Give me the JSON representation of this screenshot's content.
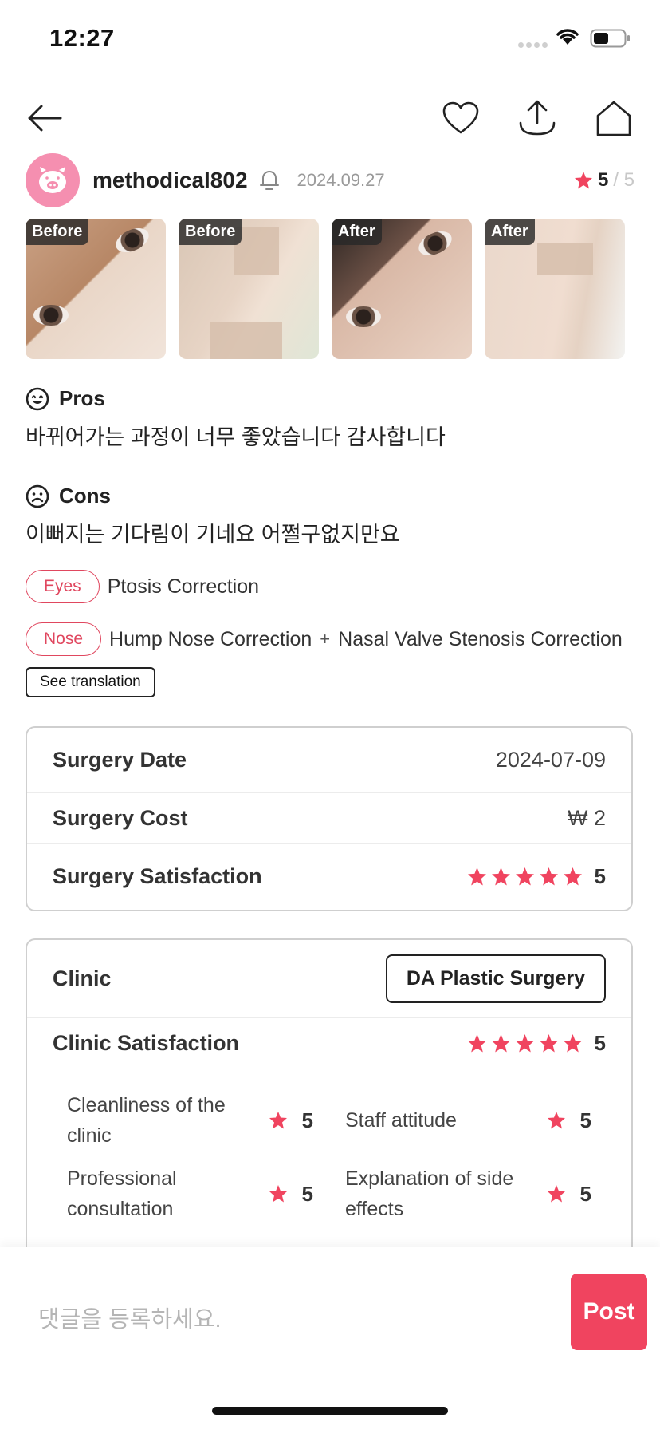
{
  "status_bar": {
    "time": "12:27"
  },
  "nav": {
    "icons": [
      "back-arrow-icon",
      "heart-icon",
      "share-upload-icon",
      "home-icon"
    ]
  },
  "post": {
    "username": "methodical802",
    "date": "2024.09.27",
    "rating": "5",
    "rating_max": "/ 5"
  },
  "photos": [
    {
      "tag": "Before"
    },
    {
      "tag": "Before"
    },
    {
      "tag": "After"
    },
    {
      "tag": "After"
    }
  ],
  "pros": {
    "label": "Pros",
    "text": "바뀌어가는 과정이 너무 좋았습니다 감사합니다"
  },
  "cons": {
    "label": "Cons",
    "text": "이뻐지는 기다림이 기네요 어쩔구없지만요"
  },
  "procedures": [
    {
      "category": "Eyes",
      "items": [
        "Ptosis Correction"
      ]
    },
    {
      "category": "Nose",
      "items": [
        "Hump Nose Correction",
        "+",
        "Nasal Valve Stenosis Correction"
      ]
    }
  ],
  "see_translation": "See translation",
  "surgery_info": {
    "date_label": "Surgery Date",
    "date_value": "2024-07-09",
    "cost_label": "Surgery Cost",
    "cost_value": "₩ 2",
    "satisfaction_label": "Surgery Satisfaction",
    "satisfaction_value": "5",
    "satisfaction_stars": 5
  },
  "clinic_info": {
    "clinic_label": "Clinic",
    "clinic_name": "DA Plastic Surgery",
    "satisfaction_label": "Clinic Satisfaction",
    "satisfaction_value": "5",
    "satisfaction_stars": 5,
    "details": [
      {
        "label": "Cleanliness of the clinic",
        "score": "5"
      },
      {
        "label": "Staff attitude",
        "score": "5"
      },
      {
        "label": "Professional consultation",
        "score": "5"
      },
      {
        "label": "Explanation of side effects",
        "score": "5"
      }
    ]
  },
  "comment": {
    "placeholder": "댓글을 등록하세요.",
    "post_label": "Post"
  },
  "colors": {
    "accent": "#f0445f",
    "star": "#f0445f",
    "avatar": "#f58fb0"
  }
}
